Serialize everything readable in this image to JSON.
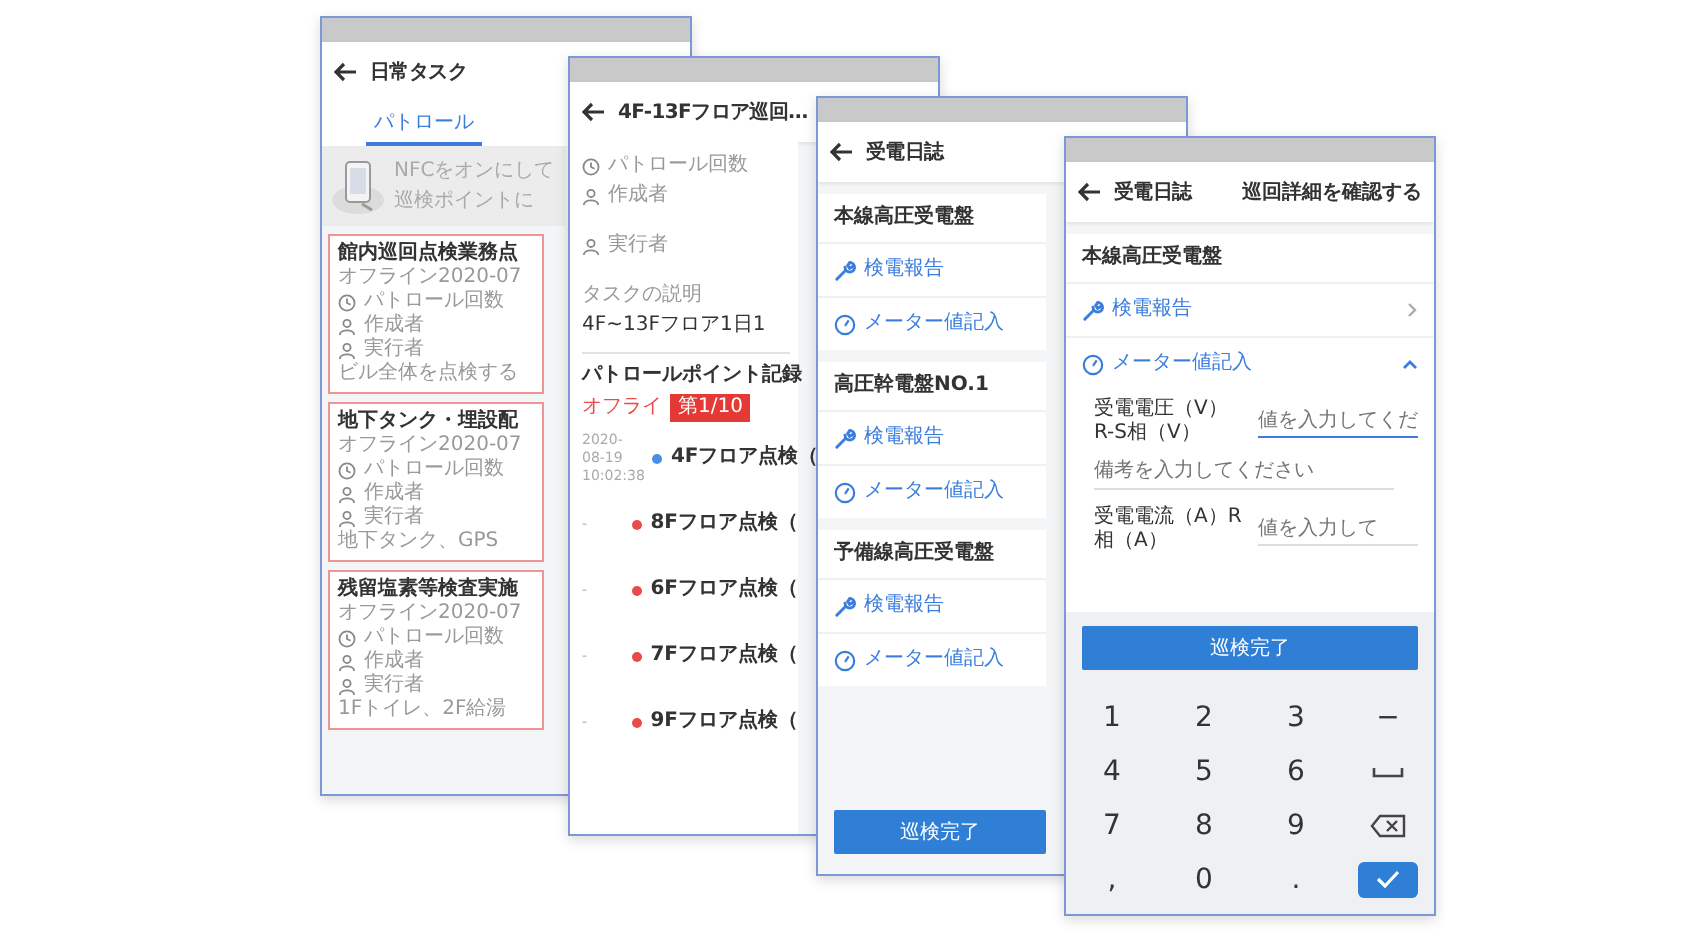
{
  "screens": [
    {
      "kind": "task_list",
      "title": "日常タスク",
      "tabs": [
        {
          "label": "パトロール",
          "selected": true
        }
      ],
      "banner": [
        "NFCをオンにして",
        "巡検ポイントに"
      ],
      "tasks": [
        {
          "title": "館内巡回点検業務点",
          "time": "オフライン2020-07",
          "count": "パトロール回数",
          "creator": "作成者",
          "executor": "実行者",
          "description": "ビル全体を点検する"
        },
        {
          "title": "地下タンク・埋設配",
          "time": "オフライン2020-07",
          "count": "パトロール回数",
          "creator": "作成者",
          "executor": "実行者",
          "description": "地下タンク、GPS"
        },
        {
          "title": "残留塩素等検査実施",
          "time": "オフライン2020-07",
          "count": "パトロール回数",
          "creator": "作成者",
          "executor": "実行者",
          "description": "1Fトイレ、2F給湯"
        }
      ]
    },
    {
      "kind": "task_detail",
      "title": "4F-13Fフロア巡回…",
      "info": [
        {
          "kind": "clock",
          "text": "パトロール回数"
        },
        {
          "kind": "person",
          "text": "作成者"
        },
        {
          "kind": "person",
          "text": "実行者"
        }
      ],
      "description_label": "タスクの説明",
      "description": "4F~13Fフロア1日1",
      "records_title": "パトロールポイント記録",
      "records_status": "オフライ",
      "badge": "第1/10",
      "points": [
        {
          "time": [
            "2020-08-19",
            "10:02:38"
          ],
          "name": "4Fフロア点検（",
          "color": "#4a90e2"
        },
        {
          "time": [
            "-"
          ],
          "name": "8Fフロア点検（",
          "color": "#e94b4b"
        },
        {
          "time": [
            "-"
          ],
          "name": "6Fフロア点検（",
          "color": "#e94b4b"
        },
        {
          "time": [
            "-"
          ],
          "name": "7Fフロア点検（",
          "color": "#e94b4b"
        },
        {
          "time": [
            "-"
          ],
          "name": "9Fフロア点検（",
          "color": "#e94b4b"
        }
      ]
    },
    {
      "kind": "panel_log",
      "title": "受電日誌",
      "panels": [
        {
          "name": "本線高圧受電盤",
          "actions": [
            {
              "kind": "report",
              "label": "検電報告"
            },
            {
              "kind": "meter",
              "label": "メーター値記入"
            }
          ]
        },
        {
          "name": "高圧幹電盤NO.1",
          "actions": [
            {
              "kind": "report",
              "label": "検電報告"
            },
            {
              "kind": "meter",
              "label": "メーター値記入"
            }
          ]
        },
        {
          "name": "予備線高圧受電盤",
          "actions": [
            {
              "kind": "report",
              "label": "検電報告"
            },
            {
              "kind": "meter",
              "label": "メーター値記入"
            }
          ]
        }
      ],
      "button": "巡検完了"
    },
    {
      "kind": "panel_form",
      "title": "受電日誌",
      "header_link": "巡回詳細を確認する",
      "panel": "本線高圧受電盤",
      "actions": [
        {
          "kind": "report",
          "label": "検電報告",
          "expanded": false
        },
        {
          "kind": "meter",
          "label": "メーター値記入",
          "expanded": true
        }
      ],
      "fields": [
        {
          "label": "受電電圧（V）R-S相（V）",
          "placeholder": "値を入力してくだ",
          "focused": true,
          "remark_placeholder": "備考を入力してください"
        },
        {
          "label": "受電電流（A）R相（A）",
          "placeholder": "値を入力して",
          "focused": false
        }
      ],
      "button": "巡検完了",
      "keypad": [
        {
          "kind": "text",
          "label": "1"
        },
        {
          "kind": "text",
          "label": "2"
        },
        {
          "kind": "text",
          "label": "3"
        },
        {
          "kind": "text",
          "label": "−"
        },
        {
          "kind": "text",
          "label": "4"
        },
        {
          "kind": "text",
          "label": "5"
        },
        {
          "kind": "text",
          "label": "6"
        },
        {
          "kind": "space"
        },
        {
          "kind": "text",
          "label": "7"
        },
        {
          "kind": "text",
          "label": "8"
        },
        {
          "kind": "text",
          "label": "9"
        },
        {
          "kind": "backspace"
        },
        {
          "kind": "text",
          "label": ","
        },
        {
          "kind": "text",
          "label": "0"
        },
        {
          "kind": "text",
          "label": "."
        },
        {
          "kind": "enter"
        }
      ]
    }
  ]
}
